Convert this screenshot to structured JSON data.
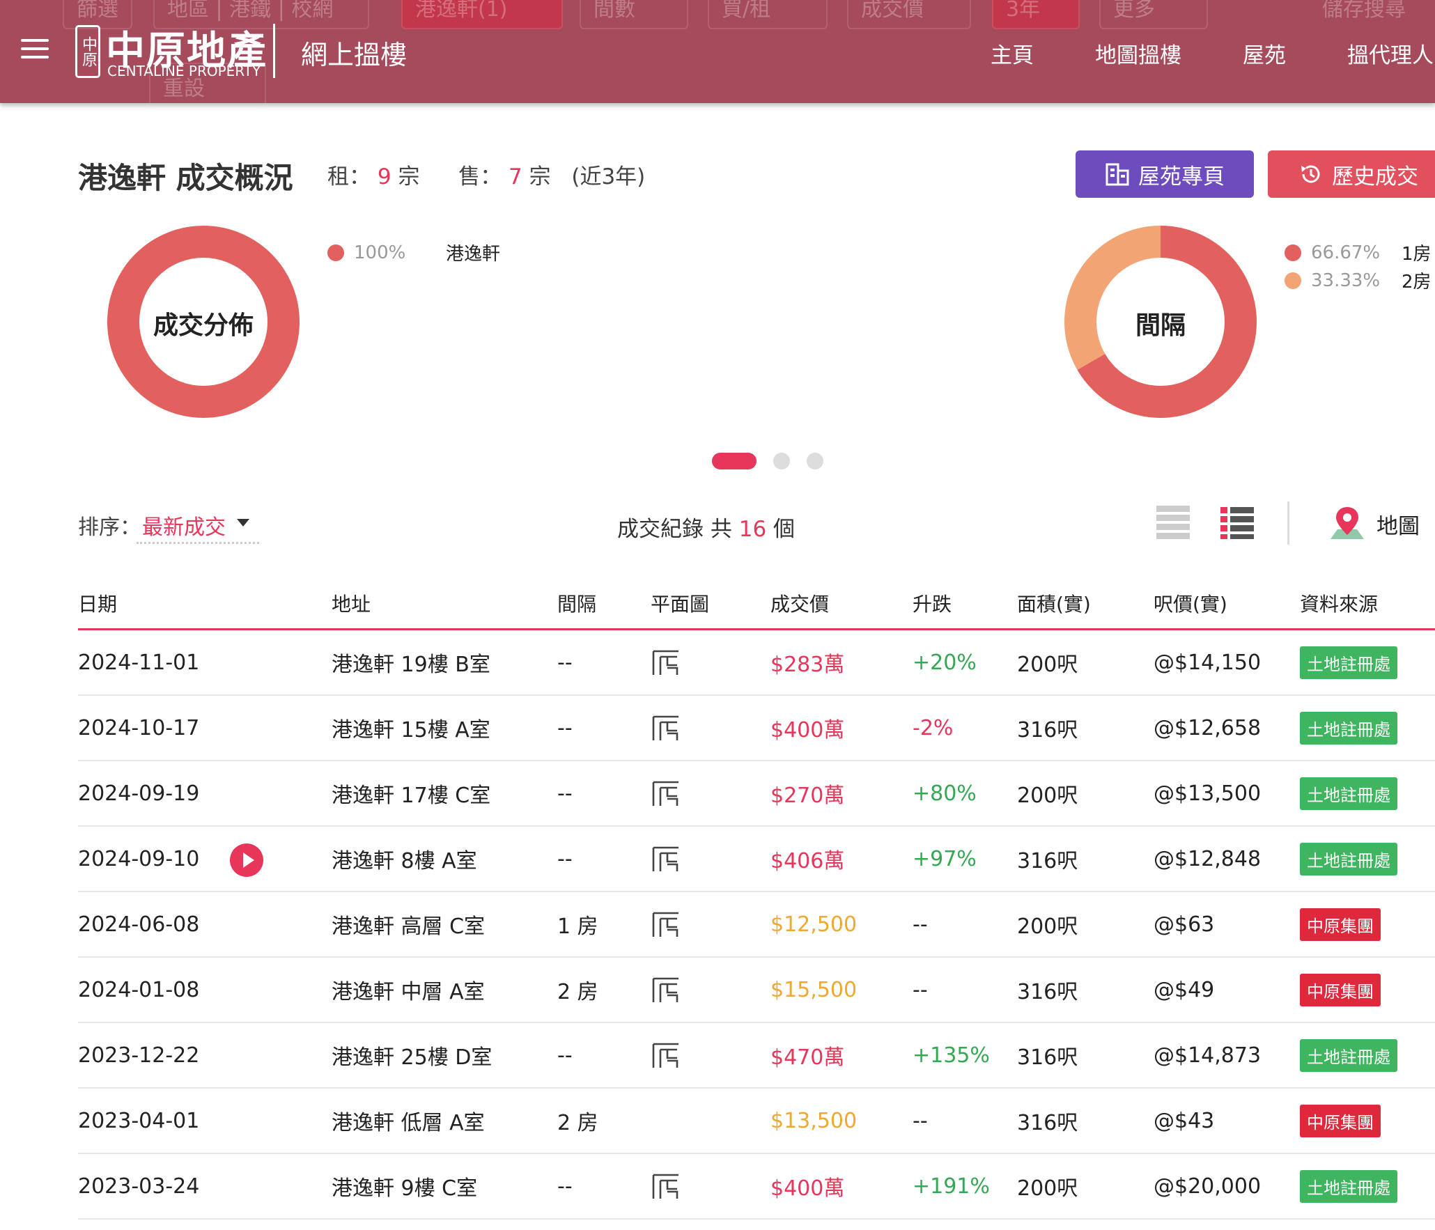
{
  "header": {
    "site_title": "網上搵樓",
    "logo_cn": "中原地產",
    "logo_en": "CENTALINE PROPERTY",
    "logo_seal": "中原",
    "nav": [
      "主頁",
      "地圖搵樓",
      "屋苑",
      "搵代理人"
    ],
    "filters": [
      "篩選",
      "地區 | 港鐵 | 校網",
      "港逸軒(1)",
      "間數",
      "買/租",
      "成交價",
      "3年",
      "更多",
      "儲存搜尋",
      "重設"
    ]
  },
  "summary": {
    "title": "港逸軒 成交概況",
    "rent_label": "租：",
    "rent_count": "9",
    "sale_label": "售：",
    "sale_count": "7",
    "unit": "宗",
    "period": "(近3年)",
    "btn_estate": "屋苑專頁",
    "btn_history": "歷史成交"
  },
  "chart_data": [
    {
      "type": "pie",
      "title": "成交分佈",
      "categories": [
        "港逸軒"
      ],
      "values": [
        100
      ],
      "labels": [
        "100%"
      ],
      "colors": [
        "#e2605e"
      ]
    },
    {
      "type": "pie",
      "title": "間隔",
      "categories": [
        "1房",
        "2房"
      ],
      "values": [
        66.67,
        33.33
      ],
      "labels": [
        "66.67%",
        "33.33%"
      ],
      "colors": [
        "#e2605e",
        "#f2a474"
      ]
    }
  ],
  "sort": {
    "label": "排序：",
    "value": "最新成交"
  },
  "records": {
    "prefix": "成交紀錄 共",
    "count": "16",
    "suffix": "個"
  },
  "map_label": "地圖",
  "table": {
    "headers": [
      "日期",
      "地址",
      "間隔",
      "平面圖",
      "成交價",
      "升跌",
      "面積(實)",
      "呎價(實)",
      "資料來源"
    ],
    "rows": [
      {
        "date": "2024-11-01",
        "addr": "港逸軒 19樓 B室",
        "room": "--",
        "plan": true,
        "price": "$283萬",
        "type": "sale",
        "chg": "+20%",
        "area": "200呎",
        "unit": "@$14,150",
        "src": "土地註冊處",
        "video": false
      },
      {
        "date": "2024-10-17",
        "addr": "港逸軒 15樓 A室",
        "room": "--",
        "plan": true,
        "price": "$400萬",
        "type": "sale",
        "chg": "-2%",
        "area": "316呎",
        "unit": "@$12,658",
        "src": "土地註冊處",
        "video": false
      },
      {
        "date": "2024-09-19",
        "addr": "港逸軒 17樓 C室",
        "room": "--",
        "plan": true,
        "price": "$270萬",
        "type": "sale",
        "chg": "+80%",
        "area": "200呎",
        "unit": "@$13,500",
        "src": "土地註冊處",
        "video": false
      },
      {
        "date": "2024-09-10",
        "addr": "港逸軒 8樓 A室",
        "room": "--",
        "plan": true,
        "price": "$406萬",
        "type": "sale",
        "chg": "+97%",
        "area": "316呎",
        "unit": "@$12,848",
        "src": "土地註冊處",
        "video": true
      },
      {
        "date": "2024-06-08",
        "addr": "港逸軒 高層 C室",
        "room": "1 房",
        "plan": true,
        "price": "$12,500",
        "type": "rent",
        "chg": "--",
        "area": "200呎",
        "unit": "@$63",
        "src": "中原集團",
        "video": false
      },
      {
        "date": "2024-01-08",
        "addr": "港逸軒 中層 A室",
        "room": "2 房",
        "plan": true,
        "price": "$15,500",
        "type": "rent",
        "chg": "--",
        "area": "316呎",
        "unit": "@$49",
        "src": "中原集團",
        "video": false
      },
      {
        "date": "2023-12-22",
        "addr": "港逸軒 25樓 D室",
        "room": "--",
        "plan": true,
        "price": "$470萬",
        "type": "sale",
        "chg": "+135%",
        "area": "316呎",
        "unit": "@$14,873",
        "src": "土地註冊處",
        "video": false
      },
      {
        "date": "2023-04-01",
        "addr": "港逸軒 低層 A室",
        "room": "2 房",
        "plan": false,
        "price": "$13,500",
        "type": "rent",
        "chg": "--",
        "area": "316呎",
        "unit": "@$43",
        "src": "中原集團",
        "video": false
      },
      {
        "date": "2023-03-24",
        "addr": "港逸軒 9樓 C室",
        "room": "--",
        "plan": true,
        "price": "$400萬",
        "type": "sale",
        "chg": "+191%",
        "area": "200呎",
        "unit": "@$20,000",
        "src": "土地註冊處",
        "video": false
      }
    ]
  },
  "colors": {
    "header_bg": "#a54b5c",
    "accent_red": "#e8355a",
    "purple": "#6e4cbe",
    "land_registry": "#3fb55f",
    "centaline": "#e0283c",
    "rent_price": "#f0a830",
    "rise": "#34a853"
  }
}
